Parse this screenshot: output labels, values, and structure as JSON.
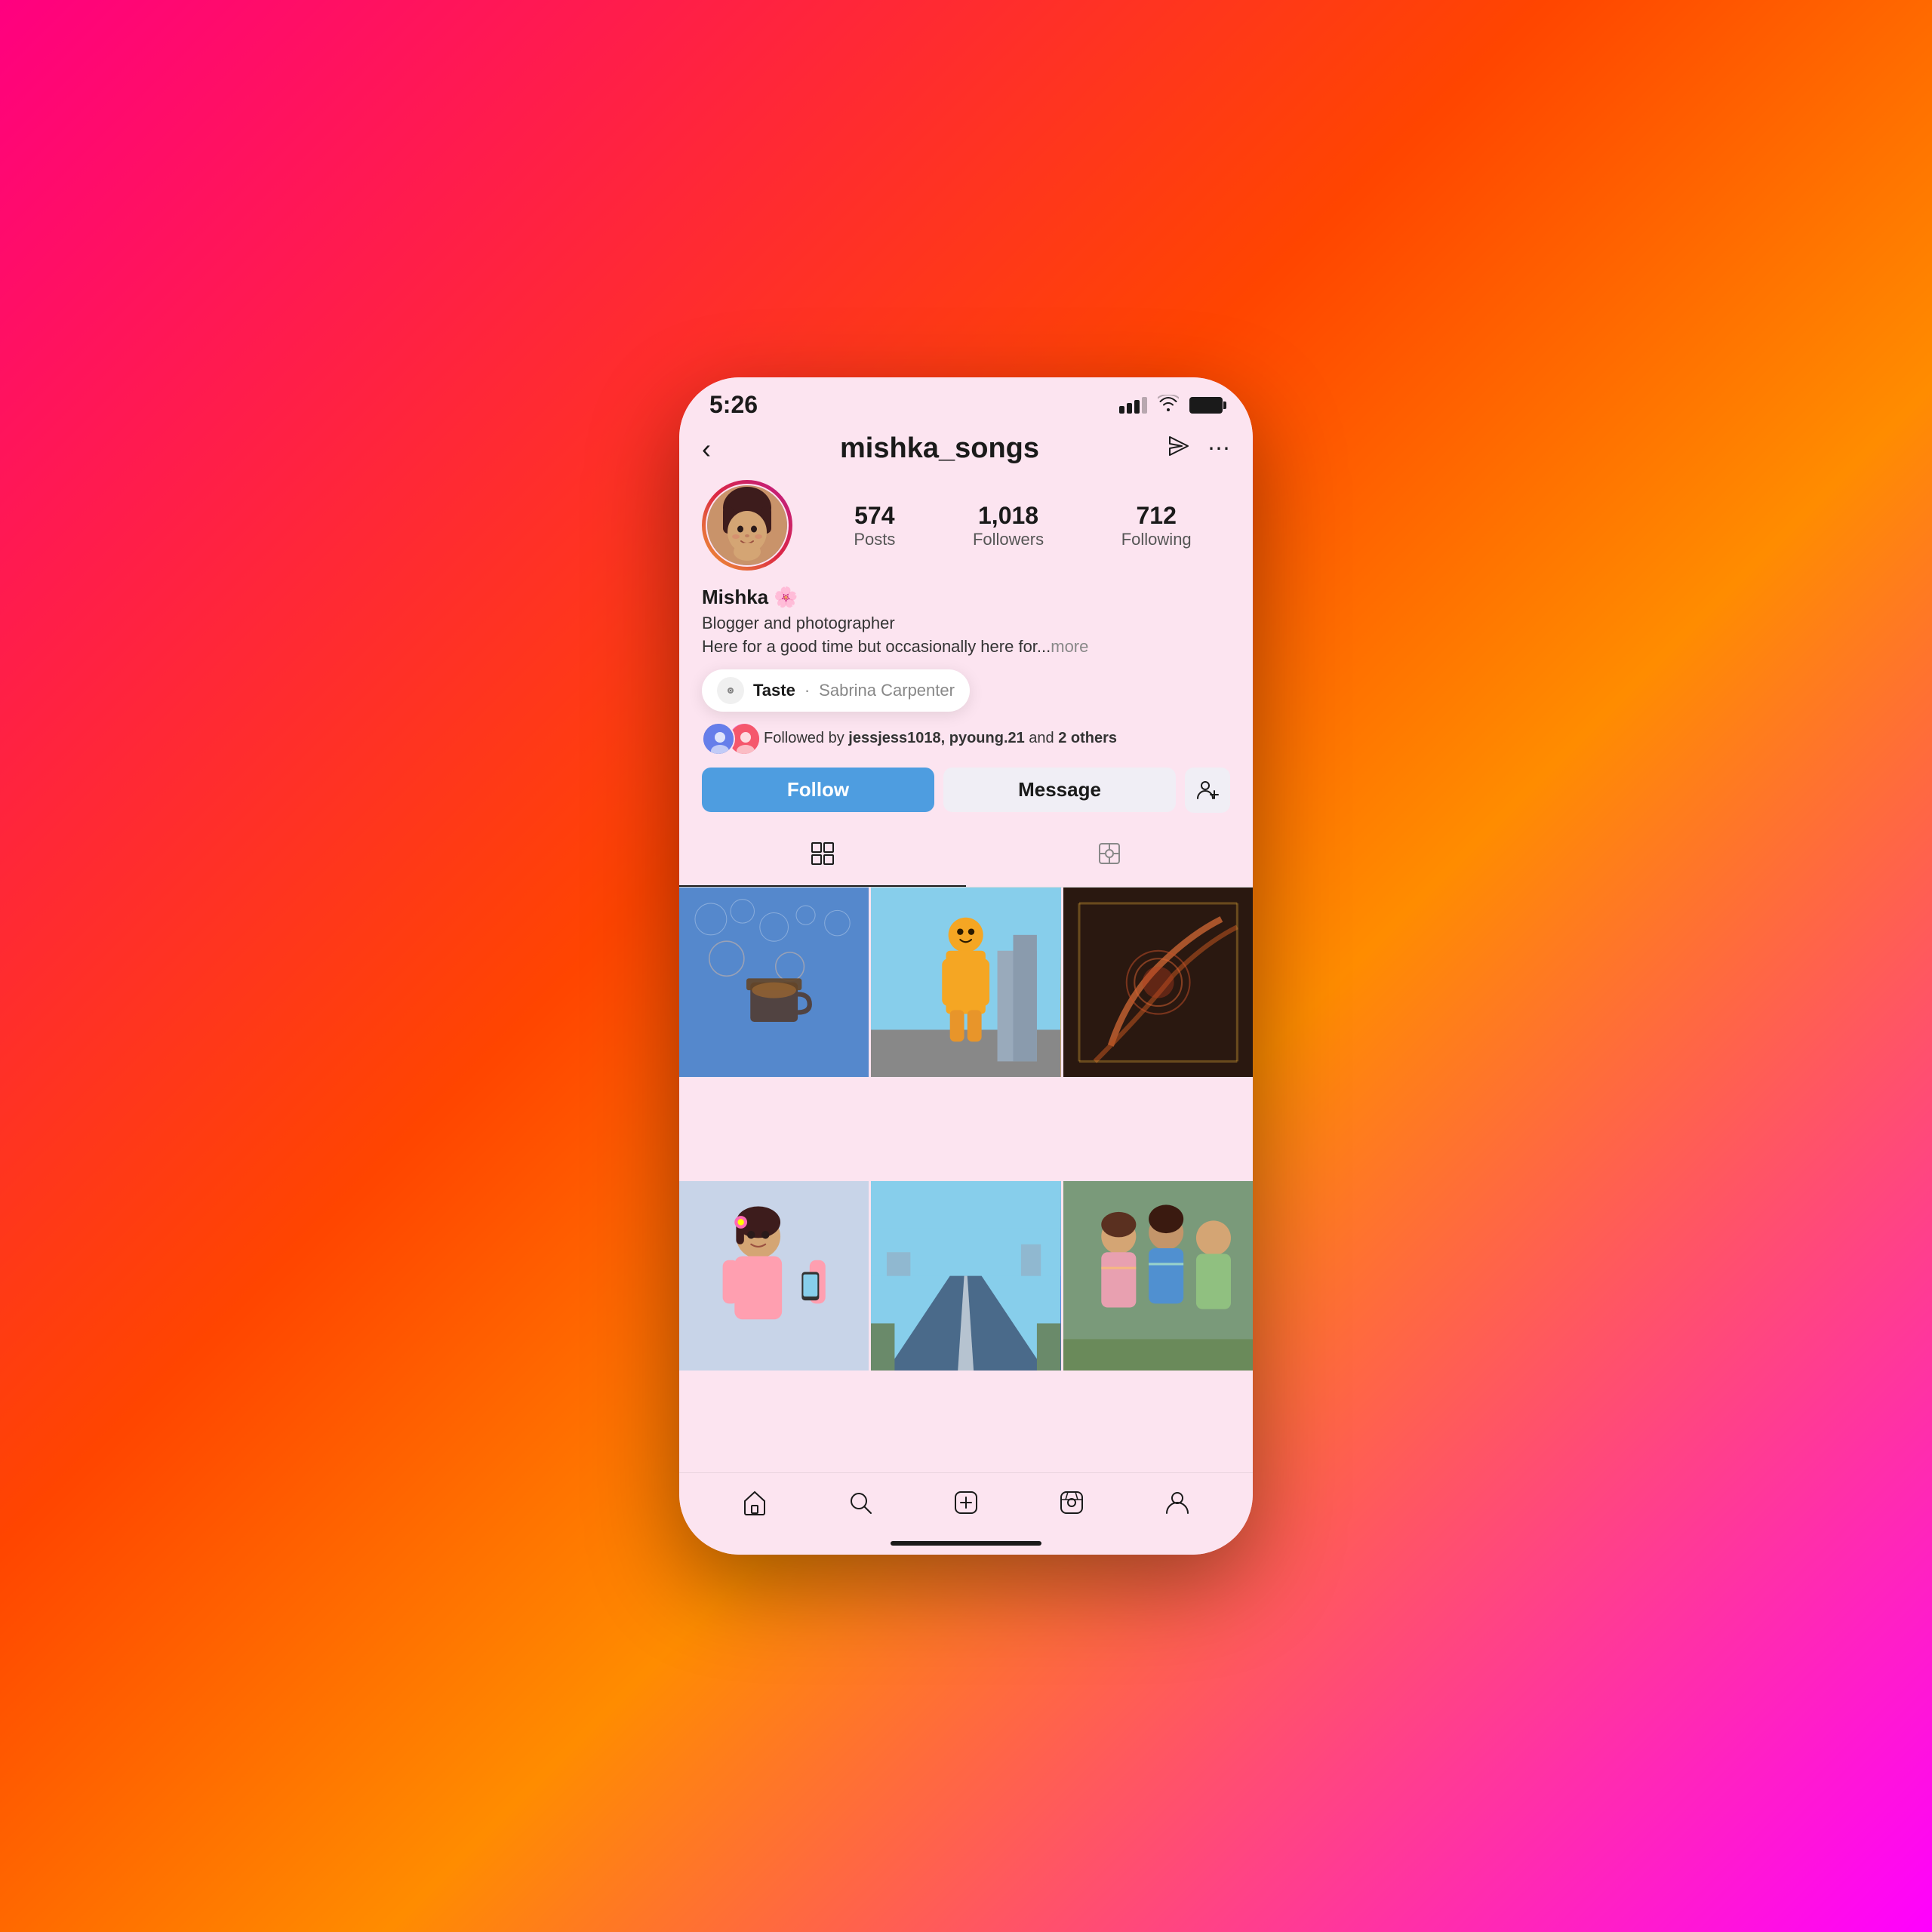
{
  "background": {
    "gradient": "linear-gradient(135deg, #ff0080, #ff4500, #ff8c00, #ff00ff)"
  },
  "statusBar": {
    "time": "5:26",
    "signalLabel": "signal-icon",
    "wifiLabel": "wifi-icon",
    "batteryLabel": "battery-icon"
  },
  "navBar": {
    "backLabel": "‹",
    "username": "mishka_songs",
    "sendIcon": "send-icon",
    "moreIcon": "more-icon"
  },
  "profile": {
    "avatarAlt": "mishka profile photo",
    "stats": {
      "posts": {
        "count": "574",
        "label": "Posts"
      },
      "followers": {
        "count": "1,018",
        "label": "Followers"
      },
      "following": {
        "count": "712",
        "label": "Following"
      }
    },
    "name": "Mishka 🌸",
    "bio1": "Blogger and photographer",
    "bio2": "Here for a good time but occasionally here for...",
    "bioMore": "more"
  },
  "musicPopup": {
    "iconSymbol": "♫",
    "trackName": "Taste",
    "separator": "·",
    "artistName": "Sabrina Carpenter"
  },
  "followedBy": {
    "text1": "Followed by ",
    "users": "jessjess1018, pyoung.21",
    "text2": " and ",
    "others": "2 others"
  },
  "actionButtons": {
    "follow": "Follow",
    "message": "Message",
    "addPersonIcon": "add-person-icon"
  },
  "tabs": {
    "grid": "grid-icon",
    "tagged": "tag-icon"
  },
  "bottomNav": {
    "home": "home-icon",
    "search": "search-icon",
    "create": "create-icon",
    "reels": "reels-icon",
    "profile": "profile-icon"
  }
}
